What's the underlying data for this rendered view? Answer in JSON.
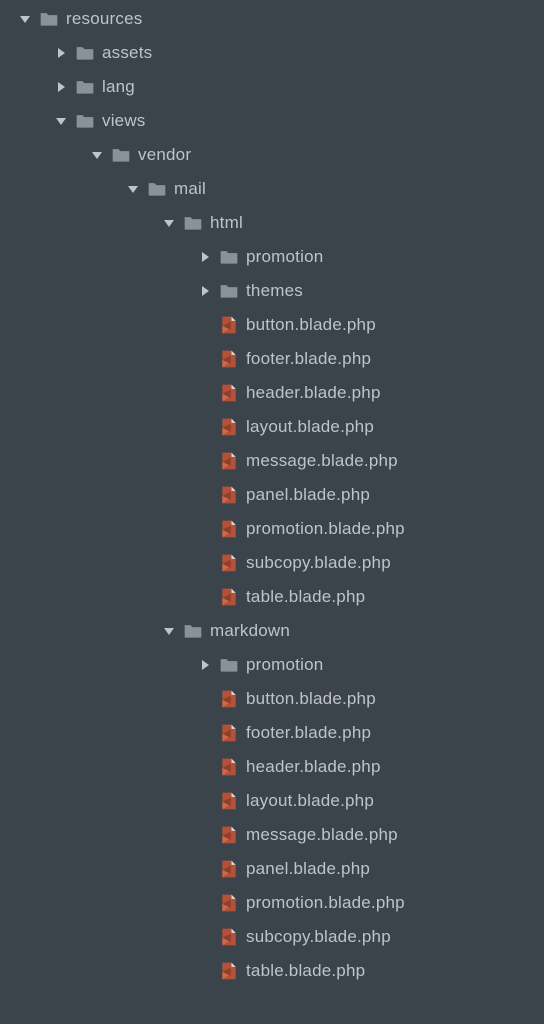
{
  "tree": [
    {
      "depth": 0,
      "state": "open",
      "kind": "folder",
      "label": "resources"
    },
    {
      "depth": 1,
      "state": "closed",
      "kind": "folder",
      "label": "assets"
    },
    {
      "depth": 1,
      "state": "closed",
      "kind": "folder",
      "label": "lang"
    },
    {
      "depth": 1,
      "state": "open",
      "kind": "folder",
      "label": "views"
    },
    {
      "depth": 2,
      "state": "open",
      "kind": "folder",
      "label": "vendor"
    },
    {
      "depth": 3,
      "state": "open",
      "kind": "folder",
      "label": "mail"
    },
    {
      "depth": 4,
      "state": "open",
      "kind": "folder",
      "label": "html"
    },
    {
      "depth": 5,
      "state": "closed",
      "kind": "folder",
      "label": "promotion"
    },
    {
      "depth": 5,
      "state": "closed",
      "kind": "folder",
      "label": "themes"
    },
    {
      "depth": 5,
      "state": "none",
      "kind": "blade",
      "label": "button.blade.php"
    },
    {
      "depth": 5,
      "state": "none",
      "kind": "blade",
      "label": "footer.blade.php"
    },
    {
      "depth": 5,
      "state": "none",
      "kind": "blade",
      "label": "header.blade.php"
    },
    {
      "depth": 5,
      "state": "none",
      "kind": "blade",
      "label": "layout.blade.php"
    },
    {
      "depth": 5,
      "state": "none",
      "kind": "blade",
      "label": "message.blade.php"
    },
    {
      "depth": 5,
      "state": "none",
      "kind": "blade",
      "label": "panel.blade.php"
    },
    {
      "depth": 5,
      "state": "none",
      "kind": "blade",
      "label": "promotion.blade.php"
    },
    {
      "depth": 5,
      "state": "none",
      "kind": "blade",
      "label": "subcopy.blade.php"
    },
    {
      "depth": 5,
      "state": "none",
      "kind": "blade",
      "label": "table.blade.php"
    },
    {
      "depth": 4,
      "state": "open",
      "kind": "folder",
      "label": "markdown"
    },
    {
      "depth": 5,
      "state": "closed",
      "kind": "folder",
      "label": "promotion"
    },
    {
      "depth": 5,
      "state": "none",
      "kind": "blade",
      "label": "button.blade.php"
    },
    {
      "depth": 5,
      "state": "none",
      "kind": "blade",
      "label": "footer.blade.php"
    },
    {
      "depth": 5,
      "state": "none",
      "kind": "blade",
      "label": "header.blade.php"
    },
    {
      "depth": 5,
      "state": "none",
      "kind": "blade",
      "label": "layout.blade.php"
    },
    {
      "depth": 5,
      "state": "none",
      "kind": "blade",
      "label": "message.blade.php"
    },
    {
      "depth": 5,
      "state": "none",
      "kind": "blade",
      "label": "panel.blade.php"
    },
    {
      "depth": 5,
      "state": "none",
      "kind": "blade",
      "label": "promotion.blade.php"
    },
    {
      "depth": 5,
      "state": "none",
      "kind": "blade",
      "label": "subcopy.blade.php"
    },
    {
      "depth": 5,
      "state": "none",
      "kind": "blade",
      "label": "table.blade.php"
    }
  ],
  "colors": {
    "folder": "#8a919b",
    "bladePrimary": "#b55138",
    "bladeCorner": "#d9dbdd",
    "disclosure": "#c0c3c8"
  },
  "indent": {
    "base": 18,
    "step": 36
  }
}
